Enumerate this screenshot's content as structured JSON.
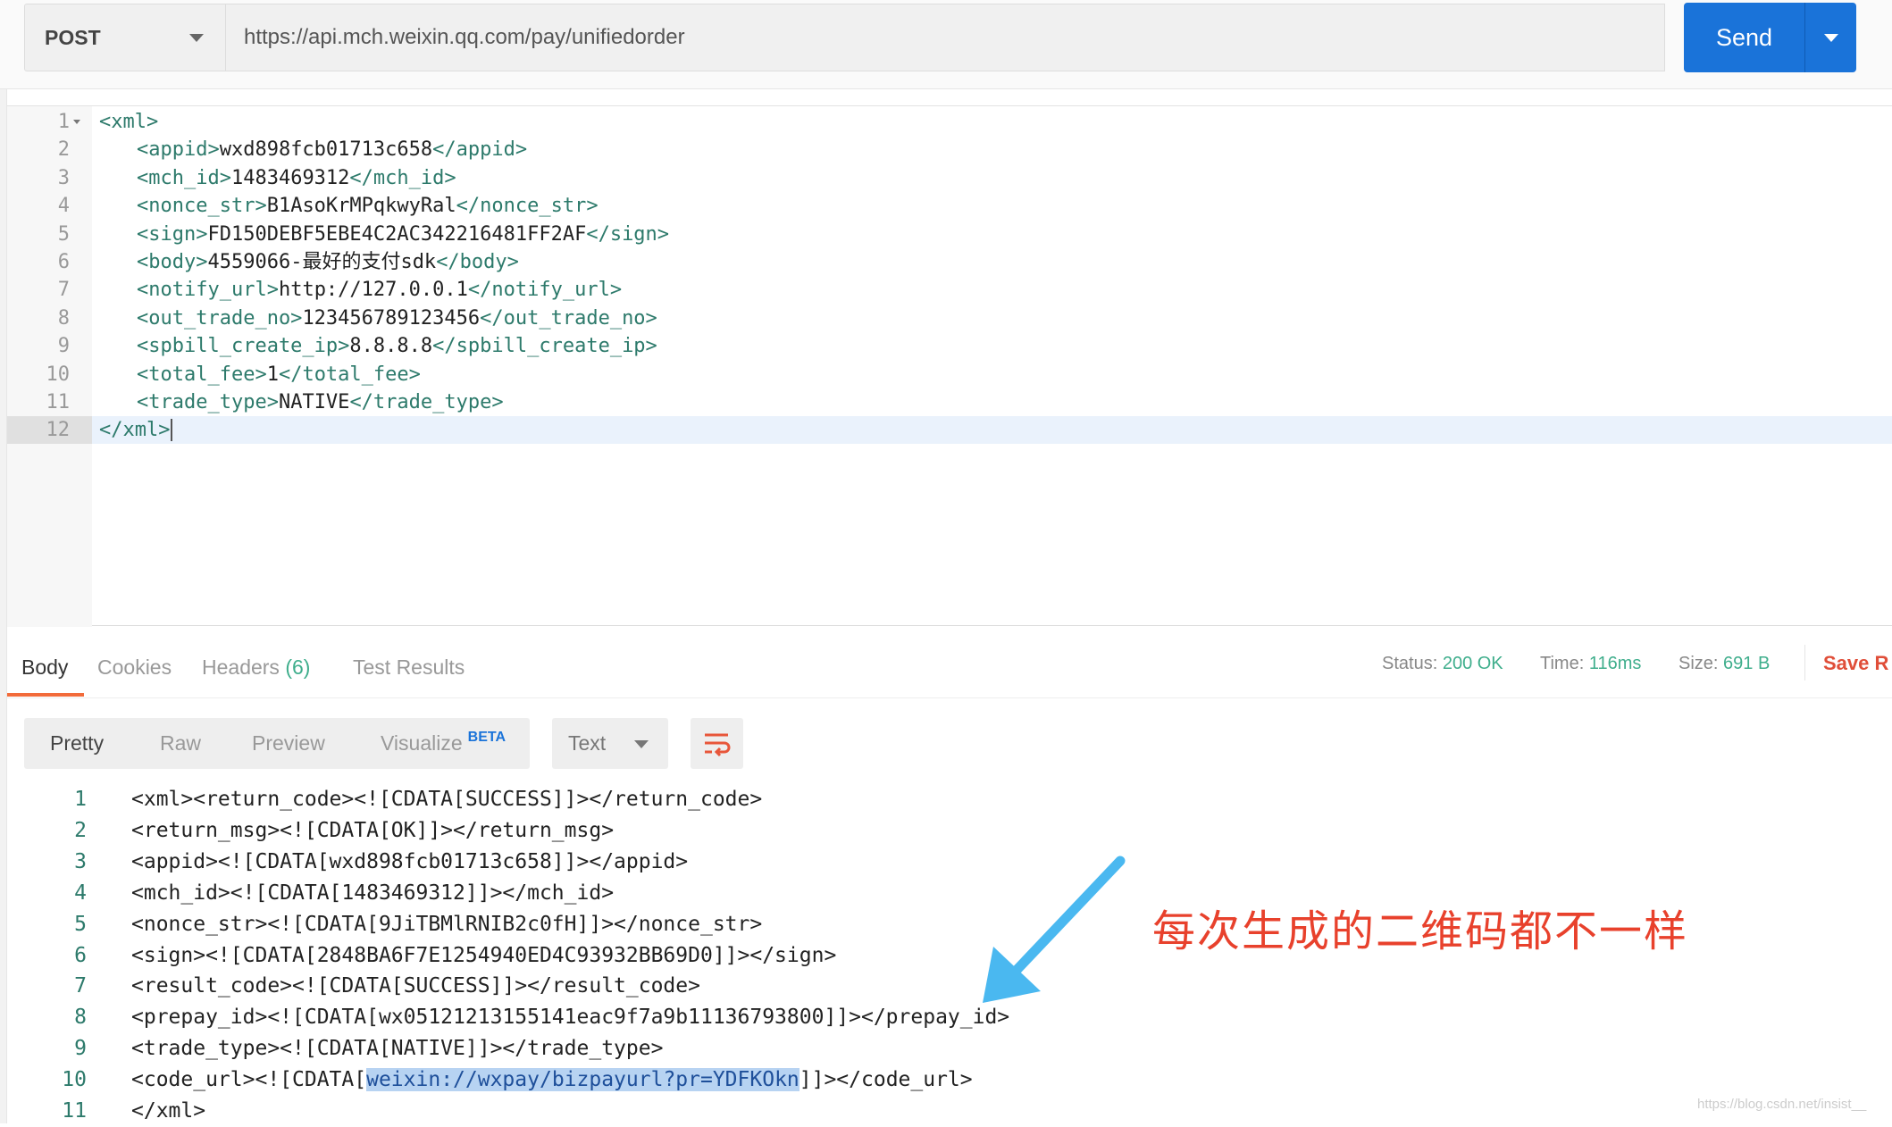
{
  "request": {
    "method": "POST",
    "url": "https://api.mch.weixin.qq.com/pay/unifiedorder",
    "send_label": "Send"
  },
  "editor": {
    "lines": [
      {
        "no": "1",
        "tag_open": "<xml>",
        "value": "",
        "tag_close": "",
        "indent": false
      },
      {
        "no": "2",
        "tag_open": "<appid>",
        "value": "wxd898fcb01713c658",
        "tag_close": "</appid>",
        "indent": true
      },
      {
        "no": "3",
        "tag_open": "<mch_id>",
        "value": "1483469312",
        "tag_close": "</mch_id>",
        "indent": true
      },
      {
        "no": "4",
        "tag_open": "<nonce_str>",
        "value": "B1AsoKrMPqkwyRal",
        "tag_close": "</nonce_str>",
        "indent": true
      },
      {
        "no": "5",
        "tag_open": "<sign>",
        "value": "FD150DEBF5EBE4C2AC342216481FF2AF",
        "tag_close": "</sign>",
        "indent": true
      },
      {
        "no": "6",
        "tag_open": "<body>",
        "value": "4559066-最好的支付sdk",
        "tag_close": "</body>",
        "indent": true
      },
      {
        "no": "7",
        "tag_open": "<notify_url>",
        "value": "http://127.0.0.1",
        "tag_close": "</notify_url>",
        "indent": true
      },
      {
        "no": "8",
        "tag_open": "<out_trade_no>",
        "value": "123456789123456",
        "tag_close": "</out_trade_no>",
        "indent": true
      },
      {
        "no": "9",
        "tag_open": "<spbill_create_ip>",
        "value": "8.8.8.8",
        "tag_close": "</spbill_create_ip>",
        "indent": true
      },
      {
        "no": "10",
        "tag_open": "<total_fee>",
        "value": "1",
        "tag_close": "</total_fee>",
        "indent": true
      },
      {
        "no": "11",
        "tag_open": "<trade_type>",
        "value": "NATIVE",
        "tag_close": "</trade_type>",
        "indent": true
      },
      {
        "no": "12",
        "tag_open": "</xml>",
        "value": "",
        "tag_close": "",
        "indent": false
      }
    ]
  },
  "response": {
    "tabs": [
      {
        "label": "Body"
      },
      {
        "label": "Cookies"
      },
      {
        "label": "Headers",
        "count": "(6)"
      },
      {
        "label": "Test Results"
      }
    ],
    "status_label": "Status:",
    "status": "200 OK",
    "time_label": "Time:",
    "time": "116ms",
    "size_label": "Size:",
    "size": "691 B",
    "save_label": "Save R",
    "views": [
      "Pretty",
      "Raw",
      "Preview",
      "Visualize"
    ],
    "beta": "BETA",
    "format": "Text",
    "lines": [
      {
        "no": "1",
        "text": "<xml><return_code><![CDATA[SUCCESS]]></return_code>"
      },
      {
        "no": "2",
        "text": "<return_msg><![CDATA[OK]]></return_msg>"
      },
      {
        "no": "3",
        "text": "<appid><![CDATA[wxd898fcb01713c658]]></appid>"
      },
      {
        "no": "4",
        "text": "<mch_id><![CDATA[1483469312]]></mch_id>"
      },
      {
        "no": "5",
        "text": "<nonce_str><![CDATA[9JiTBMlRNIB2c0fH]]></nonce_str>"
      },
      {
        "no": "6",
        "text": "<sign><![CDATA[2848BA6F7E1254940ED4C93932BB69D0]]></sign>"
      },
      {
        "no": "7",
        "text": "<result_code><![CDATA[SUCCESS]]></result_code>"
      },
      {
        "no": "8",
        "text": "<prepay_id><![CDATA[wx05121213155141eac9f7a9b11136793800]]></prepay_id>"
      },
      {
        "no": "9",
        "text": "<trade_type><![CDATA[NATIVE]]></trade_type>"
      },
      {
        "no": "10",
        "pre": "<code_url><![CDATA[",
        "selected": "weixin://wxpay/bizpayurl?pr=YDFKOkn",
        "post": "]]></code_url>"
      },
      {
        "no": "11",
        "text": "</xml>"
      }
    ]
  },
  "annotation": {
    "text": "每次生成的二维码都不一样",
    "color": "#e8412c",
    "arrow_color": "#4ab8f0"
  },
  "watermark": "https://blog.csdn.net/insist__",
  "colors": {
    "accent": "#1a73d9",
    "tab_underline": "#f26b3a",
    "status_ok": "#3fae8c"
  }
}
